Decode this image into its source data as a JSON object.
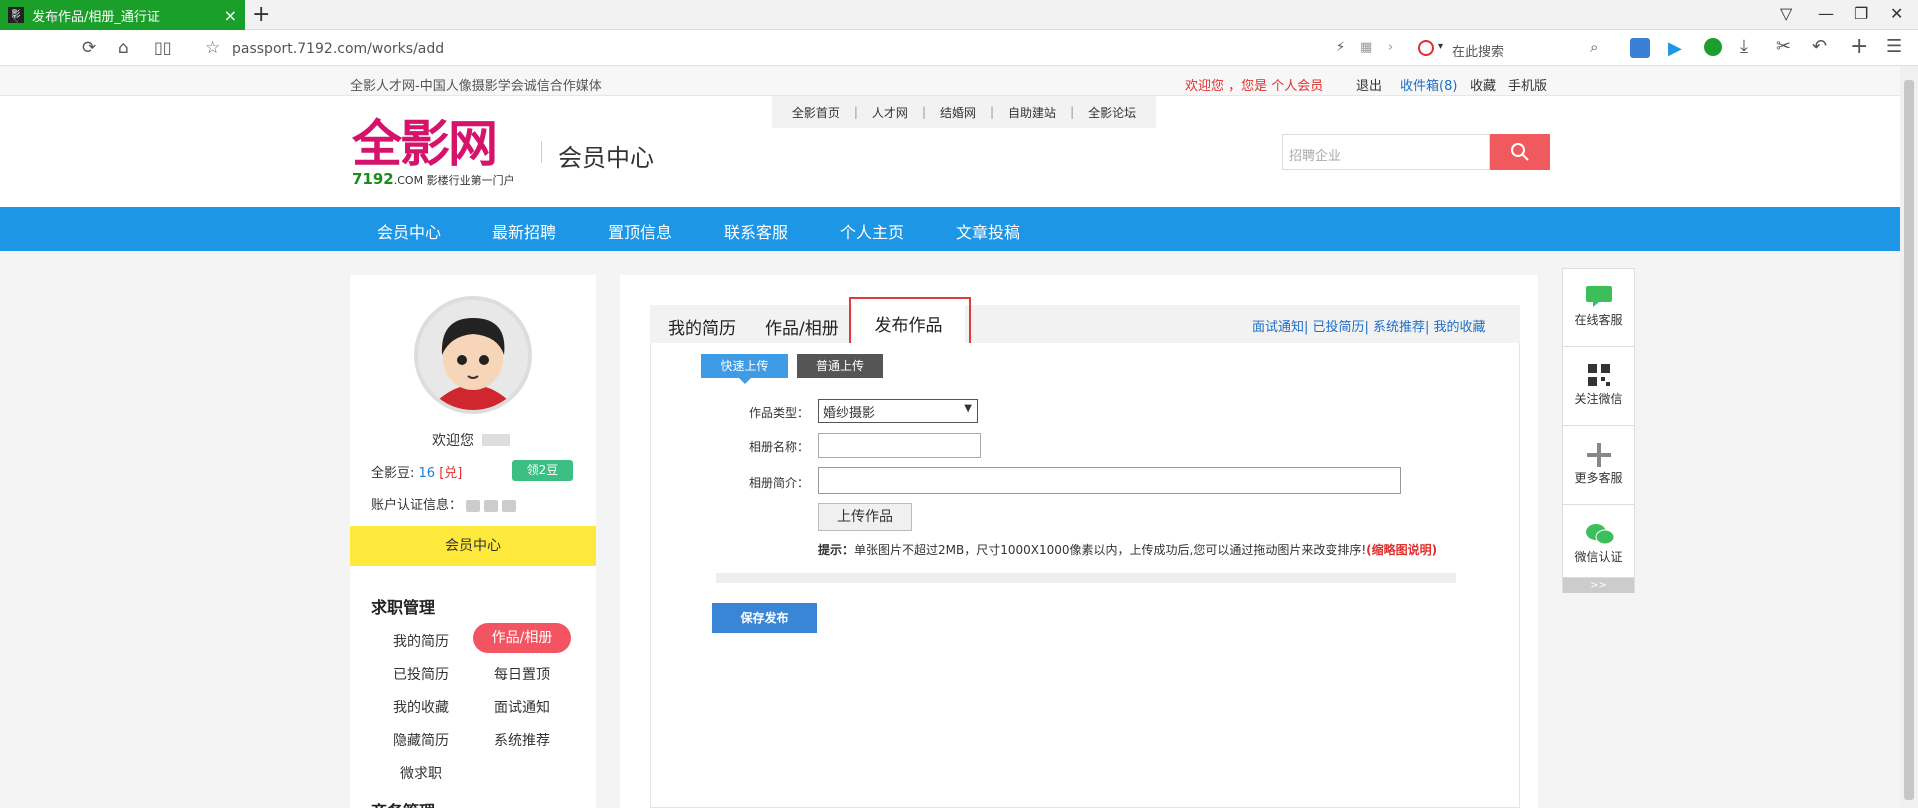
{
  "browser": {
    "tab_title": "发布作品/相册_通行证",
    "tab_close": "×",
    "new_tab": "+",
    "url": "passport.7192.com/works/add",
    "search_placeholder": "在此搜索",
    "win_controls": [
      "▽",
      "—",
      "❐",
      "✕"
    ]
  },
  "infobar": {
    "slogan": "全影人才网-中国人像摄影学会诚信合作媒体",
    "welcome": "欢迎您      ，您是 个人会员",
    "links": [
      "退出",
      "收件箱(8)",
      "收藏",
      "手机版"
    ]
  },
  "header": {
    "toplinks": [
      "全影首页",
      "人才网",
      "结婚网",
      "自助建站",
      "全影论坛"
    ],
    "logo_text": "全影网",
    "logo_num": "7192",
    "logo_com": ".COM",
    "logo_tag": "影楼行业第一门户",
    "member_center": "会员中心",
    "search_placeholder": "招聘企业"
  },
  "mainnav": [
    "会员中心",
    "最新招聘",
    "置顶信息",
    "联系客服",
    "个人主页",
    "文章投稿"
  ],
  "sidebar": {
    "welcome": "欢迎您",
    "beans_label": "全影豆:",
    "beans_value": "16",
    "exchange": "[兑]",
    "get_beans": "领2豆",
    "verify_label": "账户认证信息：",
    "member_center": "会员中心",
    "job_section": "求职管理",
    "items": [
      "我的简历",
      "作品/相册",
      "已投简历",
      "每日置顶",
      "我的收藏",
      "面试通知",
      "隐藏简历",
      "系统推荐",
      "微求职"
    ],
    "biz_section": "商务管理"
  },
  "main": {
    "tabs": [
      "我的简历",
      "作品/相册",
      "发布作品"
    ],
    "right_links": "面试通知| 已投简历| 系统推荐| 我的收藏",
    "quick_upload": "快速上传",
    "normal_upload": "普通上传",
    "type_label": "作品类型：",
    "type_value": "婚纱摄影",
    "album_name_label": "相册名称：",
    "album_desc_label": "相册简介：",
    "upload_button": "上传作品",
    "hint_label": "提示：",
    "hint_text": "单张图片不超过2MB，尺寸1000X1000像素以内，上传成功后,您可以通过拖动图片来改变排序!",
    "hint_link": "(缩略图说明)",
    "save_button": "保存发布"
  },
  "float": [
    "在线客服",
    "关注微信",
    "更多客服",
    "微信认证"
  ],
  "float_more": ">>",
  "colors": {
    "brand_blue": "#1c96e5",
    "tab_green": "#1aa02a",
    "accent_red": "#f25561",
    "highlight": "#e03c3c"
  }
}
